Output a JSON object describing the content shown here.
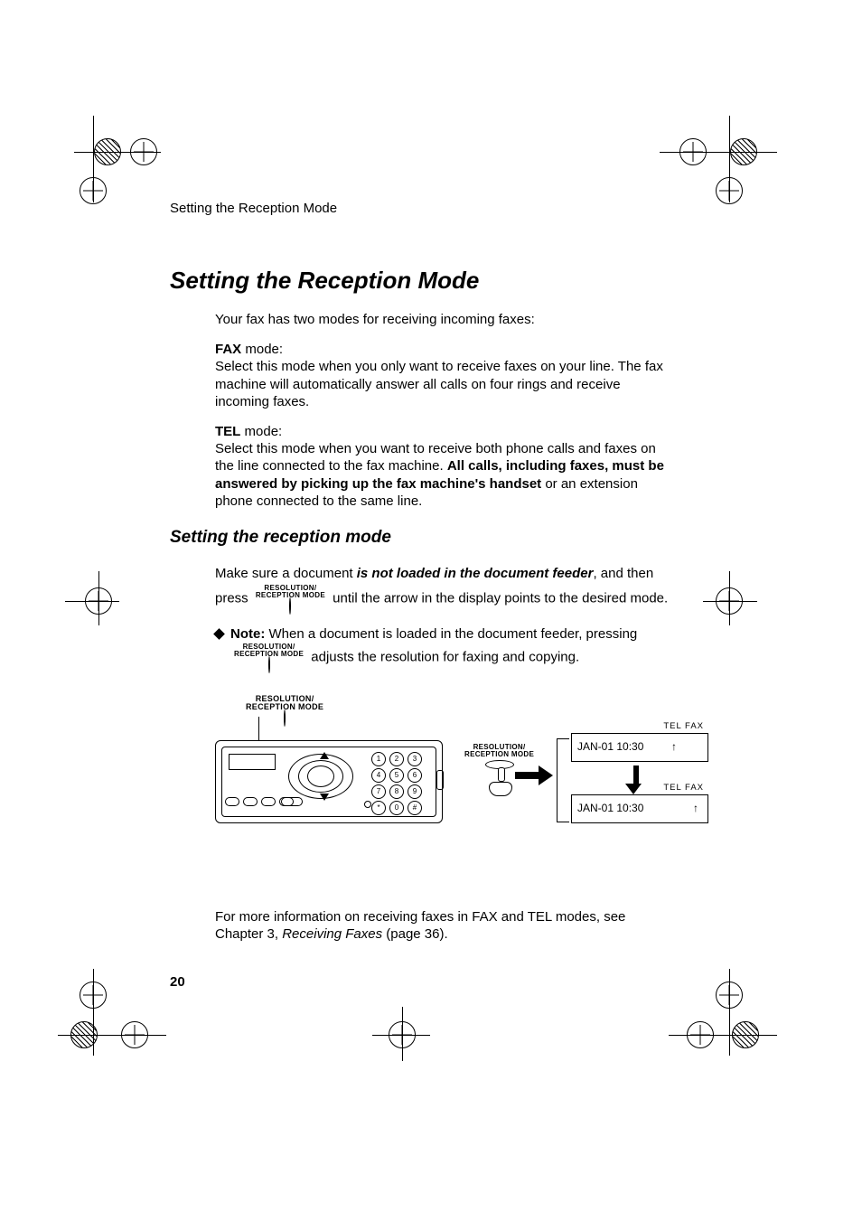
{
  "running_head": "Setting the Reception Mode",
  "h1": "Setting the Reception Mode",
  "intro": "Your fax has two modes for receiving incoming faxes:",
  "fax_mode": {
    "label": "FAX",
    "suffix": " mode:",
    "body": "Select this mode when you only want to receive faxes on your line. The fax machine will automatically answer all calls on four rings and receive incoming faxes."
  },
  "tel_mode": {
    "label": "TEL",
    "suffix": " mode:",
    "body_pre": "Select this mode when you want to receive both phone calls and faxes on the line connected to the fax machine. ",
    "body_bold": "All calls, including faxes, must be answered by picking up the fax machine's handset",
    "body_post": " or an extension phone connected to the same line."
  },
  "h2": "Setting the reception mode",
  "step": {
    "pre": "Make sure a document ",
    "em": "is not loaded in the document feeder",
    "mid": ", and then",
    "press_word": "press",
    "post": " until the arrow in the display points to the desired mode."
  },
  "note": {
    "label": "Note:",
    "pre": " When a document is loaded in the document feeder, pressing",
    "post": " adjusts the resolution for faxing and copying."
  },
  "key": {
    "line1": "RESOLUTION/",
    "line2": "RECEPTION MODE"
  },
  "keypad": {
    "rows": [
      [
        "1",
        "2",
        "3"
      ],
      [
        "4",
        "5",
        "6"
      ],
      [
        "7",
        "8",
        "9"
      ],
      [
        "*",
        "0",
        "#"
      ]
    ]
  },
  "lcd": {
    "tel_fax_label": "TEL  FAX",
    "time": "JAN-01 10:30",
    "caret": "↑"
  },
  "footer": {
    "pre": "For more information on receiving faxes in FAX and TEL modes, see Chapter 3, ",
    "em": "Receiving Faxes",
    "post": " (page 36)."
  },
  "page_number": "20"
}
